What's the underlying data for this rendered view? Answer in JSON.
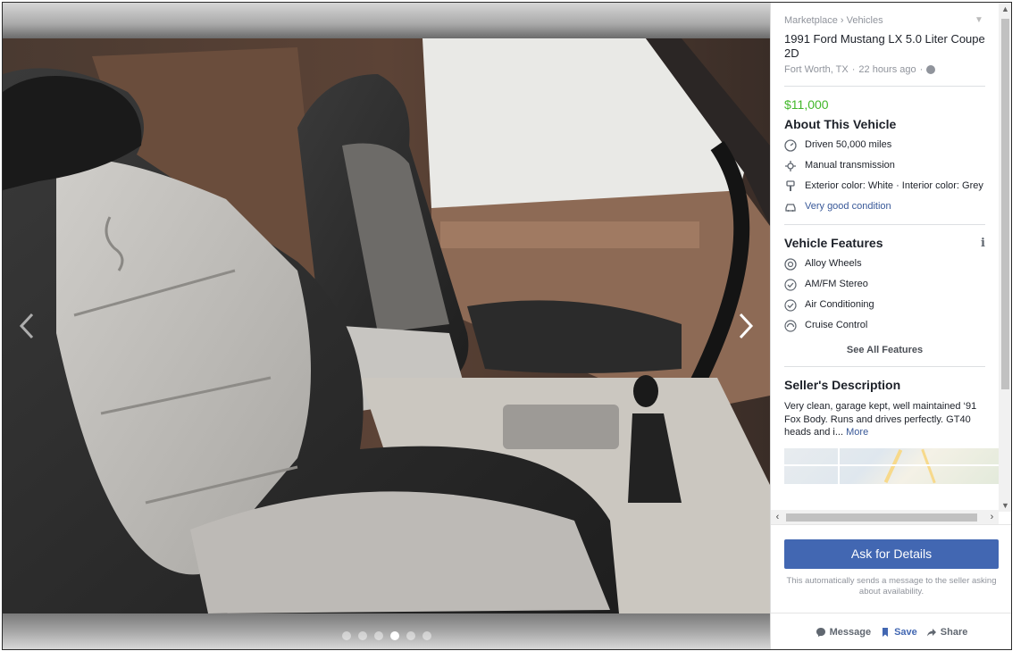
{
  "breadcrumb": {
    "root": "Marketplace",
    "separator": "›",
    "current": "Vehicles"
  },
  "listing": {
    "title": "1991 Ford Mustang LX 5.0 Liter Coupe 2D",
    "location": "Fort Worth, TX",
    "time_separator": "·",
    "posted": "22 hours ago",
    "price": "$11,000",
    "price_color": "#42b72a"
  },
  "about": {
    "heading": "About This Vehicle",
    "items": [
      {
        "icon": "speedometer-icon",
        "text": "Driven 50,000 miles",
        "is_link": false
      },
      {
        "icon": "transmission-icon",
        "text": "Manual transmission",
        "is_link": false
      },
      {
        "icon": "paint-icon",
        "text": "Exterior color: White · Interior color: Grey",
        "is_link": false
      },
      {
        "icon": "car-icon",
        "text": "Very good condition",
        "is_link": true
      }
    ]
  },
  "features": {
    "heading": "Vehicle Features",
    "info_glyph": "i",
    "items": [
      {
        "icon": "wheel-icon",
        "text": "Alloy Wheels"
      },
      {
        "icon": "check-circle-icon",
        "text": "AM/FM Stereo"
      },
      {
        "icon": "check-circle-icon",
        "text": "Air Conditioning"
      },
      {
        "icon": "cruise-control-icon",
        "text": "Cruise Control"
      }
    ],
    "see_all": "See All Features"
  },
  "seller": {
    "heading": "Seller's Description",
    "text": "Very clean, garage kept, well maintained ‘91 Fox Body. Runs and drives perfectly.  GT40 heads and i...",
    "more": "More"
  },
  "cta": {
    "button": "Ask for Details",
    "note": "This automatically sends a message to the seller asking about availability."
  },
  "actions": {
    "message": "Message",
    "save": "Save",
    "share": "Share"
  },
  "gallery": {
    "photo_count": 6,
    "active_index": 3
  },
  "colors": {
    "accent": "#4267b2",
    "link": "#385898"
  }
}
